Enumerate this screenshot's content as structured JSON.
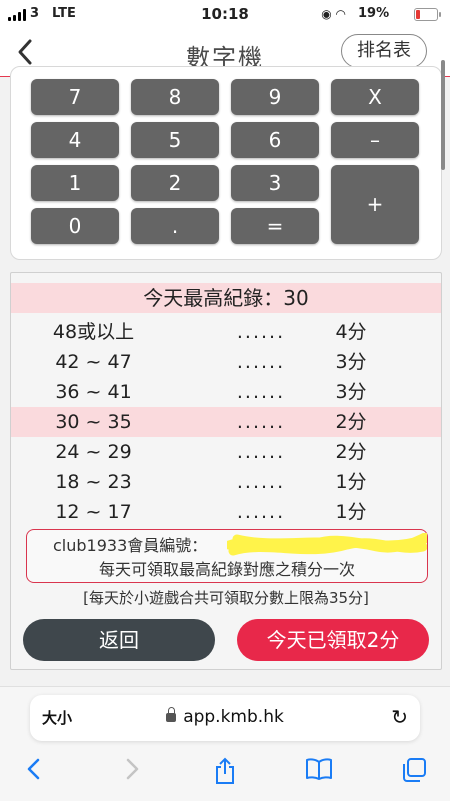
{
  "status_bar": {
    "carrier": "3",
    "network": "LTE",
    "time": "10:18",
    "battery": "19%"
  },
  "header": {
    "title": "數字機",
    "rank_label": "排名表"
  },
  "keypad": {
    "keys": [
      "7",
      "8",
      "9",
      "X",
      "4",
      "5",
      "6",
      "–",
      "1",
      "2",
      "3",
      "+",
      "0",
      ".",
      "="
    ]
  },
  "score": {
    "record": "今天最高紀錄：30",
    "rows": [
      {
        "range": "48或以上",
        "dots": "......",
        "points": "4分",
        "highlight": false
      },
      {
        "range": "42 ~ 47",
        "dots": "......",
        "points": "3分",
        "highlight": false
      },
      {
        "range": "36 ~ 41",
        "dots": "......",
        "points": "3分",
        "highlight": false
      },
      {
        "range": "30 ~ 35",
        "dots": "......",
        "points": "2分",
        "highlight": true
      },
      {
        "range": "24 ~ 29",
        "dots": "......",
        "points": "2分",
        "highlight": false
      },
      {
        "range": "18 ~ 23",
        "dots": "......",
        "points": "1分",
        "highlight": false
      },
      {
        "range": "12 ~ 17",
        "dots": "......",
        "points": "1分",
        "highlight": false
      }
    ],
    "member_label": "club1933會員編號：",
    "member_note": "每天可領取最高紀錄對應之積分一次",
    "limit_note": "[每天於小遊戲合共可領取分數上限為35分]",
    "return_label": "返回",
    "claimed_label": "今天已領取2分"
  },
  "browser": {
    "text_size_label": "大小",
    "url": "app.kmb.hk"
  },
  "colors": {
    "accent_red": "#e8284a",
    "highlight_pink": "#fadadd",
    "key_gray": "#656565",
    "dark_button": "#3f474c",
    "ios_blue": "#1a7cf5"
  }
}
